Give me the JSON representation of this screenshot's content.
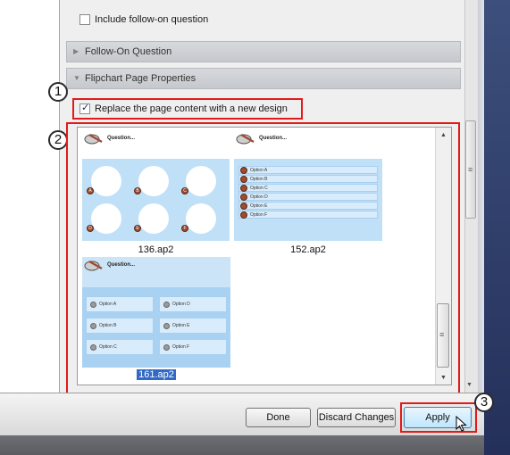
{
  "checkboxes": {
    "include_follow_on": {
      "label": "Include follow-on question",
      "checked": false
    },
    "replace_page": {
      "label": "Replace the page content with a new design",
      "checked": true
    }
  },
  "sections": {
    "follow_on": "Follow-On Question",
    "flipchart_props": "Flipchart Page Properties"
  },
  "callouts": [
    "1",
    "2",
    "3"
  ],
  "gallery": {
    "items": [
      {
        "file": "136.ap2",
        "question": "Question...",
        "badges": [
          "A",
          "B",
          "C",
          "D",
          "E",
          "F"
        ]
      },
      {
        "file": "152.ap2",
        "question": "Question...",
        "options": [
          "Option A",
          "Option B",
          "Option C",
          "Option D",
          "Option E",
          "Option F"
        ]
      },
      {
        "file": "161.ap2",
        "question": "Question...",
        "selected": true,
        "options_left": [
          "Option A",
          "Option B",
          "Option C"
        ],
        "options_right": [
          "Option D",
          "Option E",
          "Option F"
        ]
      }
    ]
  },
  "buttons": {
    "done": "Done",
    "discard": "Discard Changes",
    "apply": "Apply"
  },
  "colors": {
    "annotation_red": "#e01b1b",
    "selection_blue": "#3169c6",
    "thumb_blue": "#bfe0f7"
  }
}
